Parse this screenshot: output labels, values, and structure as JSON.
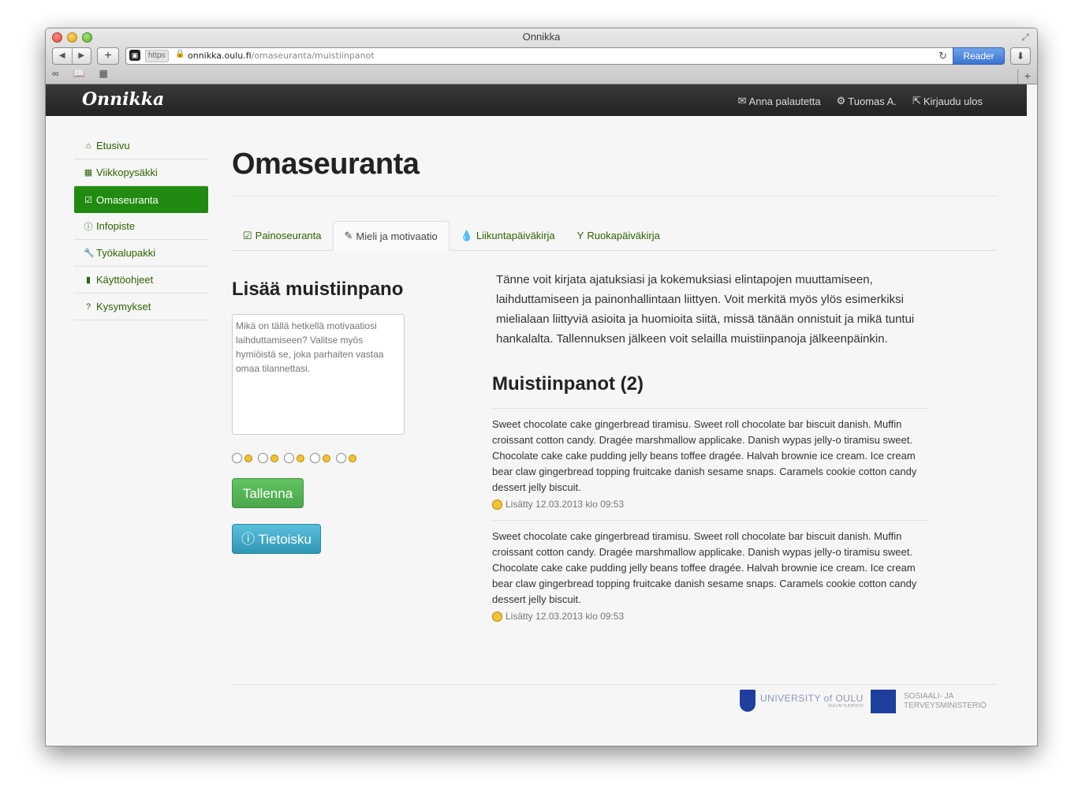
{
  "browser": {
    "window_title": "Onnikka",
    "url_scheme": "https",
    "url_host": "onnikka.oulu.fi",
    "url_path": "/omaseuranta/muistiinpanot",
    "reader_label": "Reader"
  },
  "site": {
    "brand": "Onnikka",
    "topnav": [
      {
        "label": "Anna palautetta",
        "icon": "envelope-icon"
      },
      {
        "label": "Tuomas A.",
        "icon": "gear-icon"
      },
      {
        "label": "Kirjaudu ulos",
        "icon": "logout-icon"
      }
    ]
  },
  "sidebar": {
    "items": [
      {
        "label": "Etusivu",
        "icon": "home-icon"
      },
      {
        "label": "Viikkopysäkki",
        "icon": "calendar-icon"
      },
      {
        "label": "Omaseuranta",
        "icon": "check-icon",
        "active": true
      },
      {
        "label": "Infopiste",
        "icon": "info-icon"
      },
      {
        "label": "Työkalupakki",
        "icon": "wrench-icon"
      },
      {
        "label": "Käyttöohjeet",
        "icon": "book-icon"
      },
      {
        "label": "Kysymykset",
        "icon": "question-icon"
      }
    ]
  },
  "main": {
    "title": "Omaseuranta",
    "tabs": [
      {
        "label": "Painoseuranta",
        "icon": "check-icon"
      },
      {
        "label": "Mieli ja motivaatio",
        "icon": "pencil-icon",
        "active": true
      },
      {
        "label": "Liikuntapäiväkirja",
        "icon": "drop-icon"
      },
      {
        "label": "Ruokapäiväkirja",
        "icon": "glass-icon"
      }
    ],
    "add_note": {
      "heading": "Lisää muistiinpano",
      "placeholder": "Mikä on tällä hetkellä motivaatiosi laihduttamiseen? Valitse myös hymiöistä se, joka parhaiten vastaa omaa tilannettasi.",
      "save_label": "Tallenna",
      "info_label": "Tietoisku"
    },
    "intro": "Tänne voit kirjata ajatuksiasi ja kokemuksiasi elintapojen muuttamiseen, laihduttamiseen ja painonhallintaan liittyen. Voit merkitä myös ylös esimerkiksi mielialaan liittyviä asioita ja huomioita siitä, missä tänään onnistuit ja mikä tuntui hankalalta. Tallennuksen jälkeen voit selailla muistiinpanoja jälkeenpäinkin.",
    "notes_heading": "Muistiinpanot (2)",
    "notes": [
      {
        "text": "Sweet chocolate cake gingerbread tiramisu. Sweet roll chocolate bar biscuit danish. Muffin croissant cotton candy. Dragée marshmallow applicake. Danish wypas jelly-o tiramisu sweet. Chocolate cake cake pudding jelly beans toffee dragée. Halvah brownie ice cream. Ice cream bear claw gingerbread topping fruitcake danish sesame snaps. Caramels cookie cotton candy dessert jelly biscuit.",
        "meta": "Lisätty 12.03.2013 klo 09:53"
      },
      {
        "text": "Sweet chocolate cake gingerbread tiramisu. Sweet roll chocolate bar biscuit danish. Muffin croissant cotton candy. Dragée marshmallow applicake. Danish wypas jelly-o tiramisu sweet. Chocolate cake cake pudding jelly beans toffee dragée. Halvah brownie ice cream. Ice cream bear claw gingerbread topping fruitcake danish sesame snaps. Caramels cookie cotton candy dessert jelly biscuit.",
        "meta": "Lisätty 12.03.2013 klo 09:53"
      }
    ]
  },
  "footer": {
    "university_name": "UNIVERSITY of OULU",
    "university_sub": "OULUN YLIOPISTO",
    "ministry_line1": "SOSIAALI- JA",
    "ministry_line2": "TERVEYSMINISTERIÖ"
  },
  "colors": {
    "accent_green": "#218b11",
    "link_green": "#2d6400",
    "save_button": "#5cb85c",
    "info_button": "#3aa8cc",
    "navbar": "#2b2b2b"
  }
}
